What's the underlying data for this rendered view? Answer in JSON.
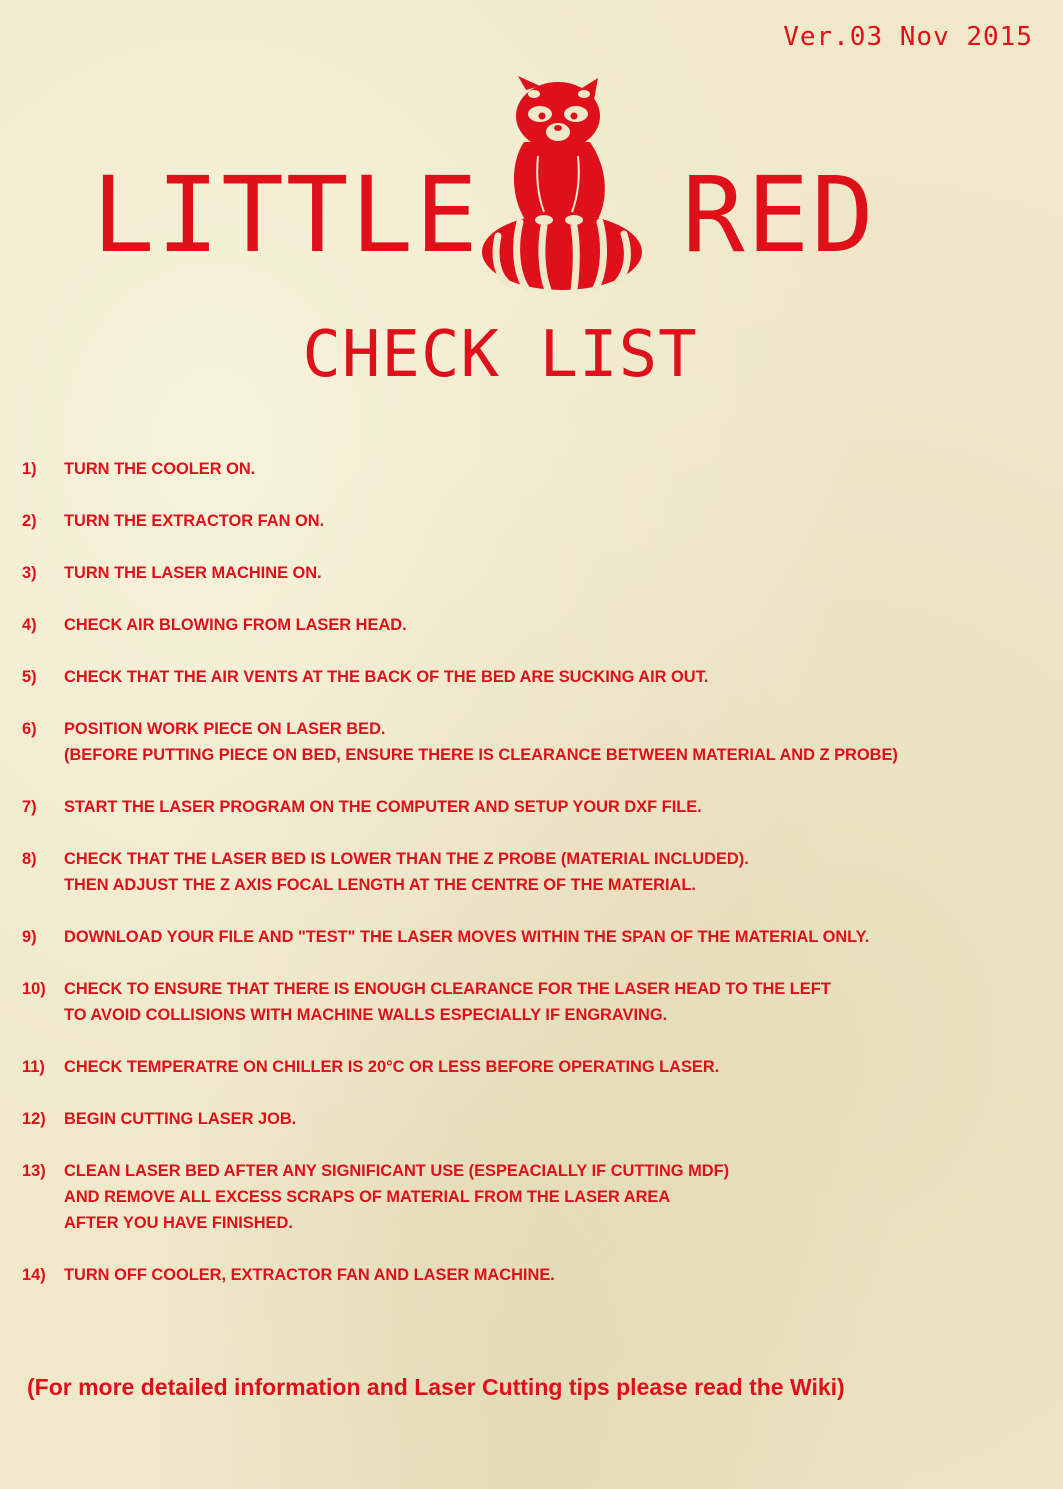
{
  "header": {
    "version": "Ver.03 Nov 2015",
    "title_left": "LITTLE",
    "title_right": "RED",
    "subtitle": "CHECK LIST"
  },
  "mascot": {
    "icon": "red-panda-icon",
    "color": "#e0101a"
  },
  "checklist": [
    {
      "num": "1)",
      "lines": [
        "TURN THE COOLER ON."
      ]
    },
    {
      "num": "2)",
      "lines": [
        "TURN THE EXTRACTOR FAN ON."
      ]
    },
    {
      "num": "3)",
      "lines": [
        "TURN THE LASER MACHINE ON."
      ]
    },
    {
      "num": "4)",
      "lines": [
        "CHECK AIR BLOWING FROM LASER HEAD."
      ]
    },
    {
      "num": "5)",
      "lines": [
        "CHECK THAT THE AIR VENTS AT THE BACK OF THE BED ARE SUCKING AIR OUT."
      ]
    },
    {
      "num": "6)",
      "lines": [
        "POSITION WORK PIECE ON LASER BED.",
        "(BEFORE PUTTING PIECE ON BED, ENSURE THERE IS CLEARANCE BETWEEN MATERIAL AND Z PROBE)"
      ]
    },
    {
      "num": "7)",
      "lines": [
        "START THE LASER PROGRAM ON THE COMPUTER AND SETUP YOUR DXF FILE."
      ]
    },
    {
      "num": "8)",
      "lines": [
        "CHECK THAT THE LASER BED IS LOWER THAN THE Z PROBE (MATERIAL INCLUDED).",
        "THEN ADJUST THE Z AXIS FOCAL LENGTH AT THE CENTRE OF THE MATERIAL."
      ]
    },
    {
      "num": "9)",
      "lines": [
        "DOWNLOAD YOUR FILE AND \"TEST\" THE LASER MOVES WITHIN THE SPAN OF THE MATERIAL ONLY."
      ]
    },
    {
      "num": "10)",
      "lines": [
        "CHECK TO ENSURE THAT THERE IS ENOUGH CLEARANCE FOR THE LASER HEAD TO THE LEFT",
        "TO AVOID COLLISIONS WITH MACHINE WALLS ESPECIALLY IF ENGRAVING."
      ]
    },
    {
      "num": "11)",
      "lines": [
        "CHECK TEMPERATRE ON CHILLER IS 20°C OR LESS BEFORE OPERATING LASER."
      ]
    },
    {
      "num": "12)",
      "lines": [
        "BEGIN CUTTING LASER JOB."
      ]
    },
    {
      "num": "13)",
      "lines": [
        "CLEAN LASER BED AFTER ANY SIGNIFICANT USE (ESPEACIALLY IF CUTTING MDF)",
        "AND REMOVE ALL EXCESS SCRAPS OF MATERIAL FROM THE LASER AREA",
        "AFTER YOU HAVE FINISHED."
      ]
    },
    {
      "num": "14)",
      "lines": [
        "TURN OFF COOLER, EXTRACTOR FAN AND LASER MACHINE."
      ]
    }
  ],
  "footer": {
    "note": "(For more detailed information and Laser Cutting tips please read the Wiki)"
  }
}
